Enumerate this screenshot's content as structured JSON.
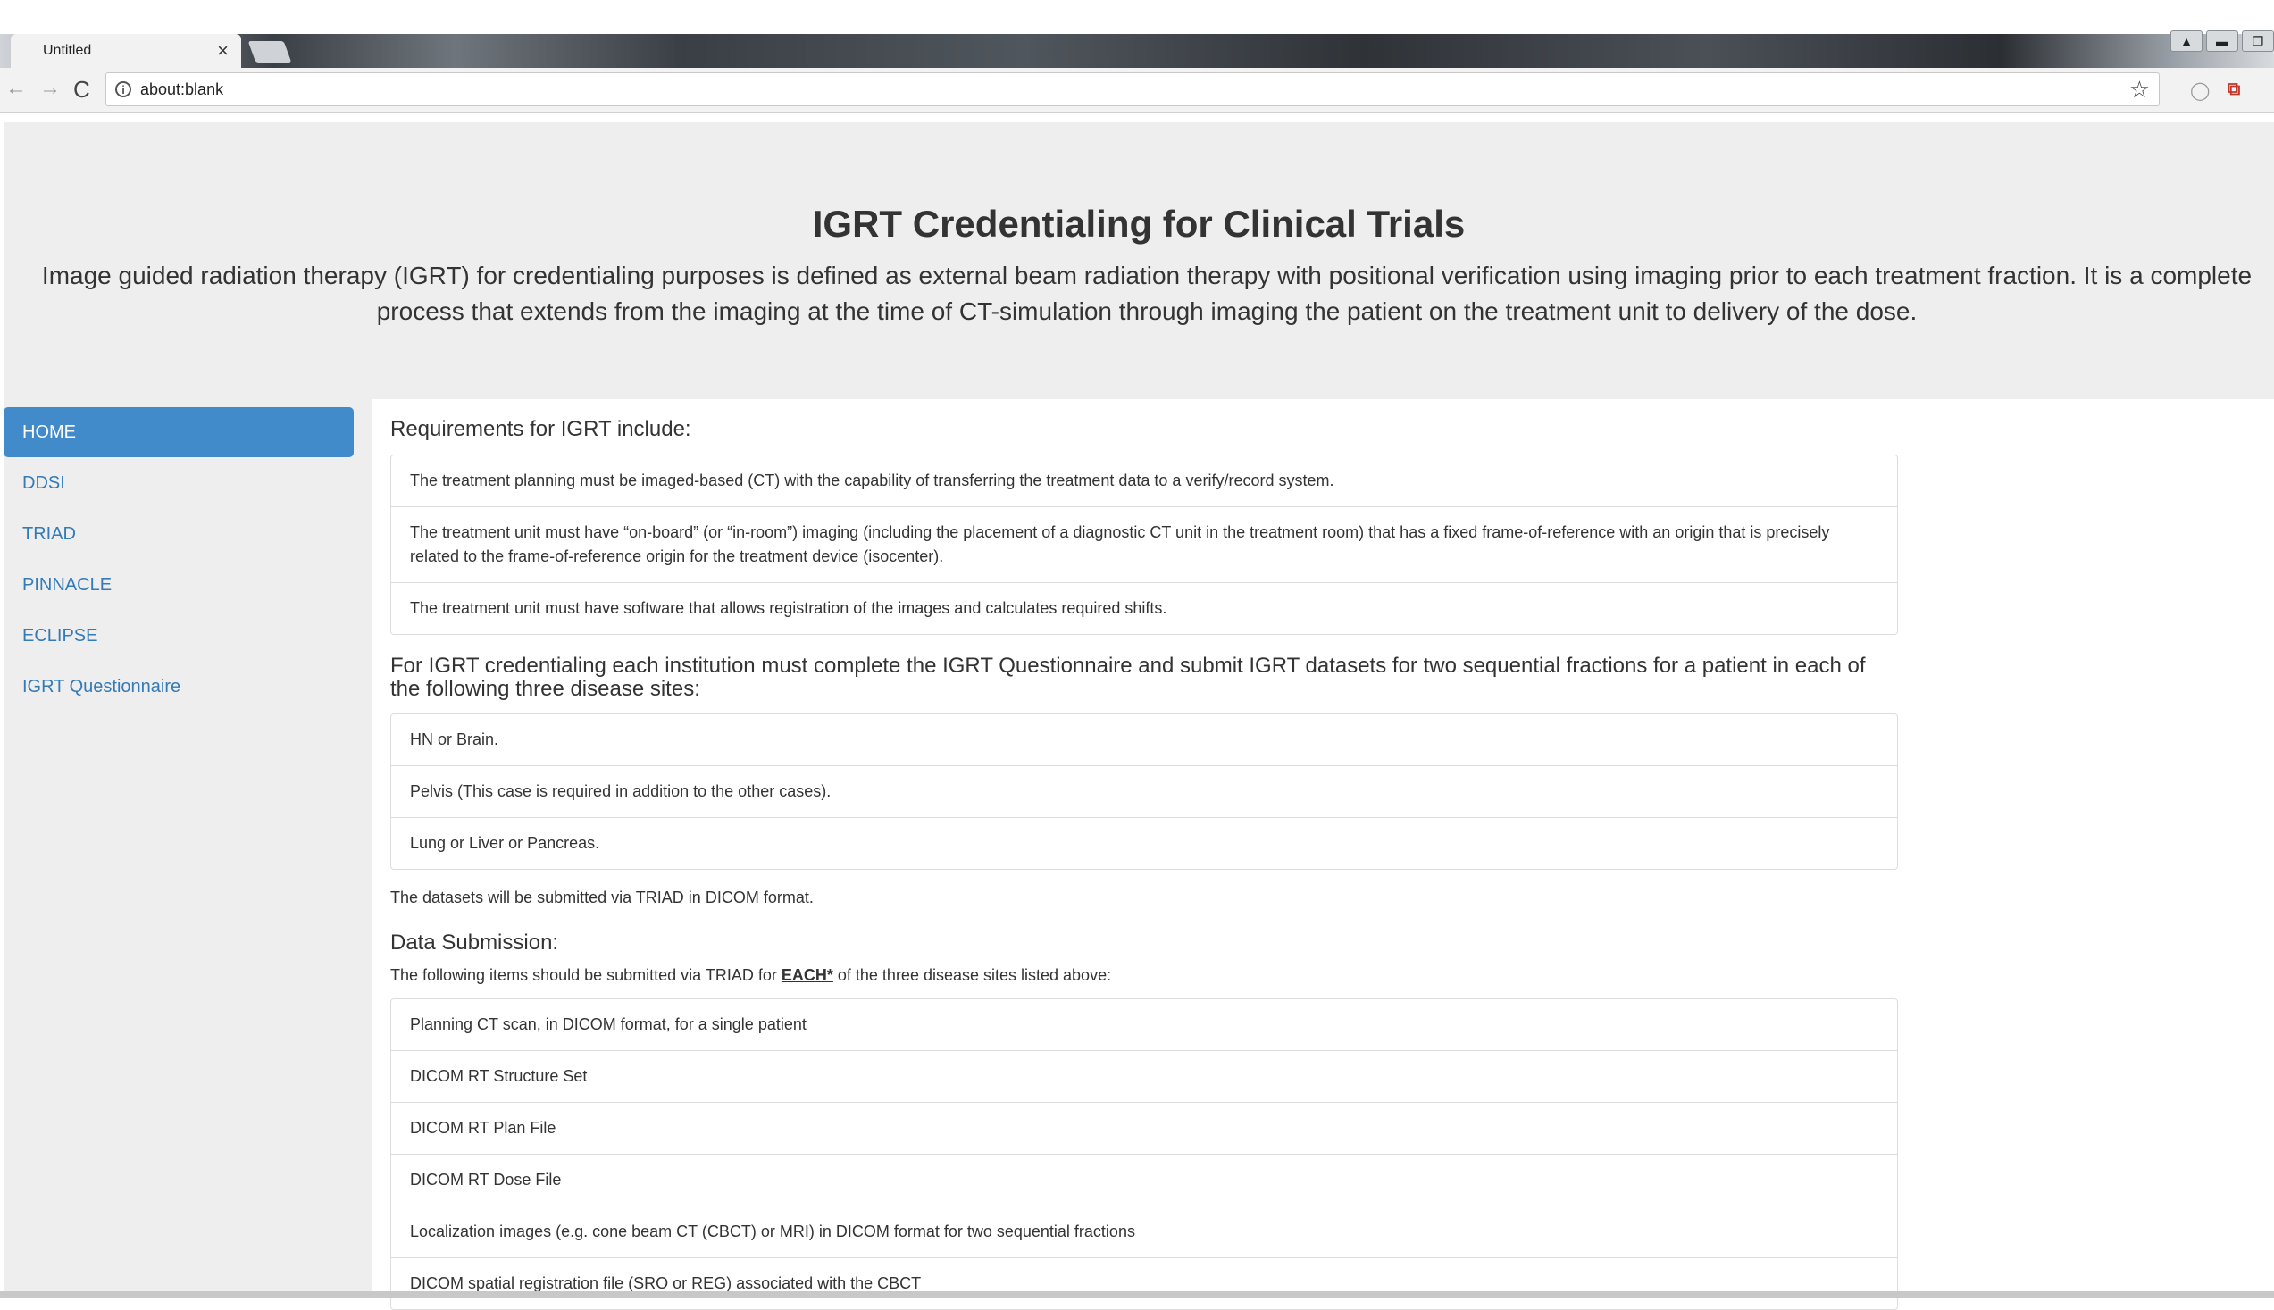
{
  "browser": {
    "tab_title": "Untitled",
    "tab_close": "×",
    "url": "about:blank",
    "back": "←",
    "forward": "→",
    "reload": "C",
    "star": "☆",
    "info": "i"
  },
  "hero": {
    "title": "IGRT Credentialing for Clinical Trials",
    "line1": "Image guided radiation therapy (IGRT) for credentialing purposes is defined as external beam radiation therapy with positional verification using imaging prior to each treatment fraction. It is a complete",
    "line2": "process that extends from the imaging at the time of CT-simulation through imaging the patient on the treatment unit to delivery of the dose."
  },
  "sidebar": {
    "items": [
      {
        "label": "HOME"
      },
      {
        "label": "DDSI"
      },
      {
        "label": "TRIAD"
      },
      {
        "label": "PINNACLE"
      },
      {
        "label": "ECLIPSE"
      },
      {
        "label": "IGRT Questionnaire"
      }
    ]
  },
  "content": {
    "requirements_heading": "Requirements for IGRT include:",
    "requirements": [
      "The treatment planning must be imaged-based (CT) with the capability of transferring the treatment data to a verify/record system.",
      "The treatment unit must have “on-board” (or “in-room”) imaging (including the placement of a diagnostic CT unit in the treatment room) that has a fixed frame-of-reference with an origin that is precisely related to the frame-of-reference origin for the treatment device (isocenter).",
      "The treatment unit must have software that allows registration of the images and calculates required shifts."
    ],
    "credentialing_heading": "For IGRT credentialing each institution must complete the IGRT Questionnaire and submit IGRT datasets for two sequential fractions for a patient in each of the following three disease sites:",
    "sites": [
      "HN or Brain.",
      "Pelvis (This case is required in addition to the other cases).",
      "Lung or Liver or Pancreas."
    ],
    "datasets_note": "The datasets will be submitted via TRIAD in DICOM format.",
    "submission_heading": "Data Submission:",
    "submission_intro_pre": "The following items should be submitted via TRIAD for ",
    "submission_intro_bold": "EACH*",
    "submission_intro_post": " of the three disease sites listed above:",
    "submission_items": [
      "Planning CT scan, in DICOM format, for a single patient",
      "DICOM RT Structure Set",
      "DICOM RT Plan File",
      "DICOM RT Dose File",
      "Localization images (e.g. cone beam CT (CBCT) or MRI) in DICOM format for two sequential fractions",
      "DICOM spatial registration file (SRO or REG) associated with the CBCT"
    ]
  }
}
